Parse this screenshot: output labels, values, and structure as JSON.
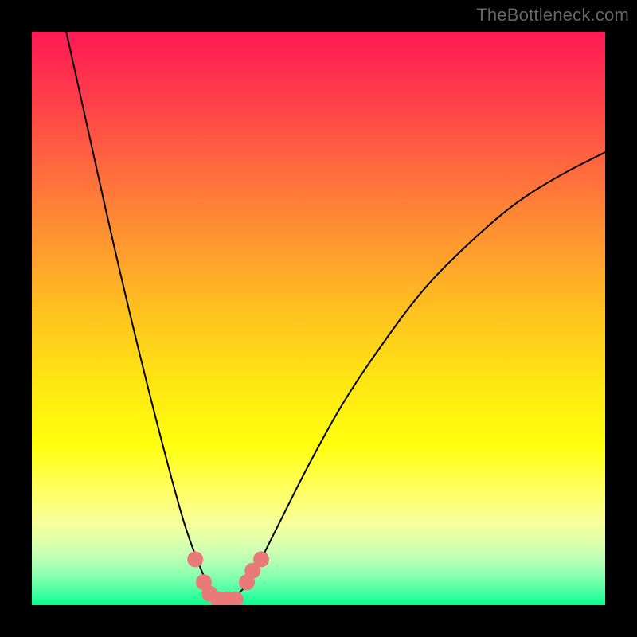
{
  "watermark": "TheBottleneck.com",
  "chart_data": {
    "type": "line",
    "title": "",
    "xlabel": "",
    "ylabel": "",
    "xlim": [
      0,
      100
    ],
    "ylim": [
      0,
      100
    ],
    "grid": false,
    "background_gradient": {
      "top": "#ff1a55",
      "mid": "#ffe313",
      "bottom": "#06ff8e"
    },
    "series": [
      {
        "name": "curve",
        "color": "#000000",
        "x": [
          6,
          10,
          14,
          18,
          22,
          26,
          28,
          30,
          31,
          32,
          33,
          34,
          35,
          36,
          38,
          40,
          44,
          48,
          54,
          60,
          68,
          76,
          84,
          92,
          100
        ],
        "y": [
          100,
          82,
          64,
          47,
          31,
          16,
          10,
          5,
          3,
          2,
          1,
          1,
          1,
          2,
          4,
          8,
          16,
          24,
          35,
          44,
          55,
          63,
          70,
          75,
          79
        ]
      }
    ],
    "markers": {
      "name": "highlight-dots",
      "color": "#e97a7a",
      "radius_px": 10,
      "points": [
        {
          "x": 28.5,
          "y": 8
        },
        {
          "x": 30,
          "y": 4
        },
        {
          "x": 31,
          "y": 2
        },
        {
          "x": 32.5,
          "y": 1
        },
        {
          "x": 34,
          "y": 1
        },
        {
          "x": 35.5,
          "y": 1
        },
        {
          "x": 37.5,
          "y": 4
        },
        {
          "x": 38.5,
          "y": 6
        },
        {
          "x": 40,
          "y": 8
        }
      ]
    }
  }
}
